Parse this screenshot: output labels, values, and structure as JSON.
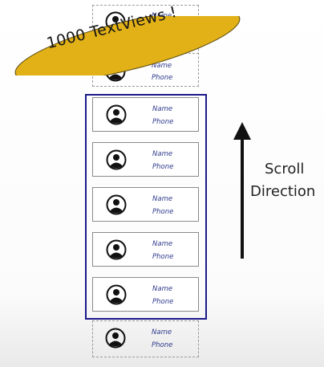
{
  "badge": {
    "text": "1000 TextViews !"
  },
  "direction": {
    "line1": "Scroll",
    "line2": "Direction"
  },
  "row": {
    "name_label": "Name",
    "phone_label": "Phone"
  },
  "colors": {
    "badge_fill": "#e1b117",
    "viewport_border": "#1b1a8a",
    "label_color": "#2e3a8c"
  },
  "icons": {
    "avatar": "person-avatar-icon",
    "arrow": "up-arrow-icon"
  }
}
